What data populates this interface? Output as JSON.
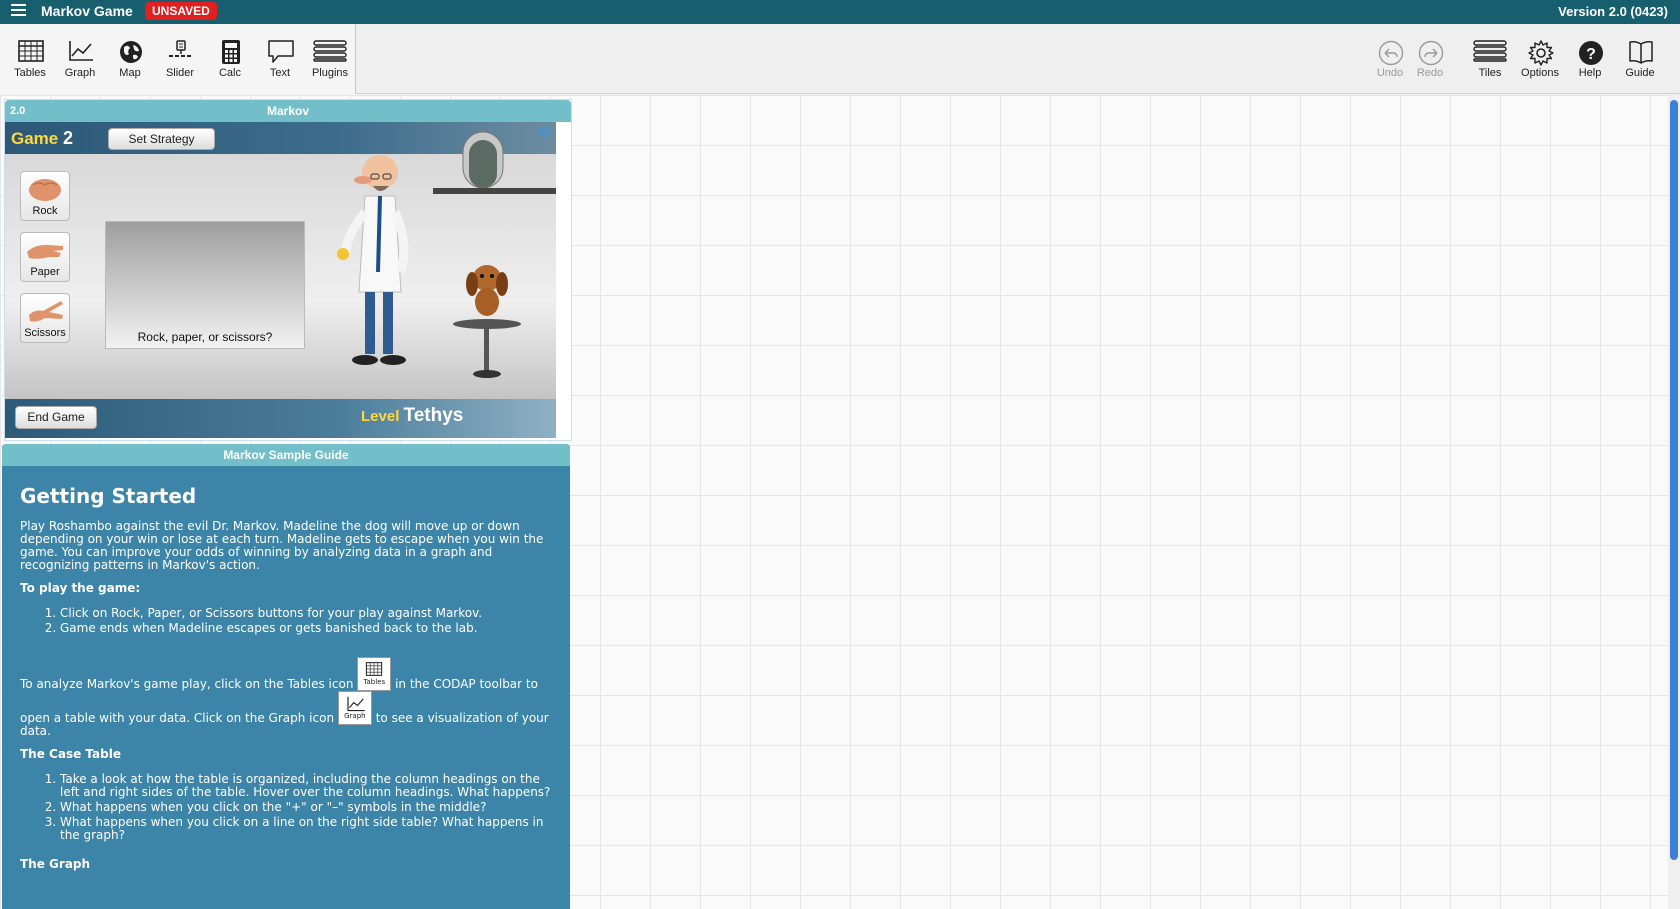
{
  "app": {
    "title": "Markov Game",
    "status_badge": "UNSAVED",
    "version": "Version 2.0 (0423)"
  },
  "toolbar": {
    "left": [
      {
        "name": "tables",
        "label": "Tables",
        "icon": "table-icon"
      },
      {
        "name": "graph",
        "label": "Graph",
        "icon": "graph-icon"
      },
      {
        "name": "map",
        "label": "Map",
        "icon": "globe-icon"
      },
      {
        "name": "slider",
        "label": "Slider",
        "icon": "slider-icon"
      },
      {
        "name": "calc",
        "label": "Calc",
        "icon": "calculator-icon"
      },
      {
        "name": "text",
        "label": "Text",
        "icon": "speech-bubble-icon"
      },
      {
        "name": "plugins",
        "label": "Plugins",
        "icon": "list-icon"
      }
    ],
    "right": [
      {
        "name": "undo",
        "label": "Undo",
        "icon": "undo-icon",
        "disabled": true
      },
      {
        "name": "redo",
        "label": "Redo",
        "icon": "redo-icon",
        "disabled": true
      },
      {
        "name": "tiles",
        "label": "Tiles",
        "icon": "list-icon"
      },
      {
        "name": "options",
        "label": "Options",
        "icon": "gear-icon"
      },
      {
        "name": "help",
        "label": "Help",
        "icon": "question-icon"
      },
      {
        "name": "guide",
        "label": "Guide",
        "icon": "book-icon"
      }
    ]
  },
  "game_tile": {
    "title": "Markov",
    "version": "2.0",
    "game_prefix": "Game",
    "game_number": "2",
    "set_strategy_label": "Set Strategy",
    "buttons": {
      "rock": "Rock",
      "paper": "Paper",
      "scissors": "Scissors"
    },
    "prompt": "Rock, paper, or scissors?",
    "end_game_label": "End Game",
    "level_prefix": "Level",
    "level_name": "Tethys"
  },
  "guide_tile": {
    "title": "Markov Sample Guide",
    "heading": "Getting Started",
    "intro": "Play Roshambo against the evil Dr. Markov. Madeline the dog will move up or down depending on your win or lose at each turn. Madeline gets to escape when you win the game. You can improve your odds of winning by analyzing data in a graph and recognizing patterns in Markov's action.",
    "play_heading": "To play the game:",
    "play_steps": [
      "Click on Rock, Paper, or Scissors buttons for your play against Markov.",
      "Game ends when Madeline escapes or gets banished back to the lab."
    ],
    "analyze_1": "To analyze Markov's game play, click on the Tables icon",
    "analyze_2": "in the CODAP toolbar to open a table with your data. Click on the Graph icon",
    "analyze_3": "to see a visualization of your data.",
    "inline_tables": "Tables",
    "inline_graph": "Graph",
    "case_heading": "The Case Table",
    "case_steps": [
      "Take a look at how the table is organized, including the column headings on the left and right sides of the table. Hover over the column headings. What happens?",
      "What happens when you click on the \"+\" or \"–\" symbols in the middle?",
      "What happens when you click on a line on the right side table? What happens in the graph?"
    ],
    "graph_heading": "The Graph"
  },
  "colors": {
    "topbar": "#175f6e",
    "tile_title": "#73bfc9",
    "guide_bg": "#3c85a8",
    "badge": "#e02020",
    "level": "#ffd83a"
  }
}
